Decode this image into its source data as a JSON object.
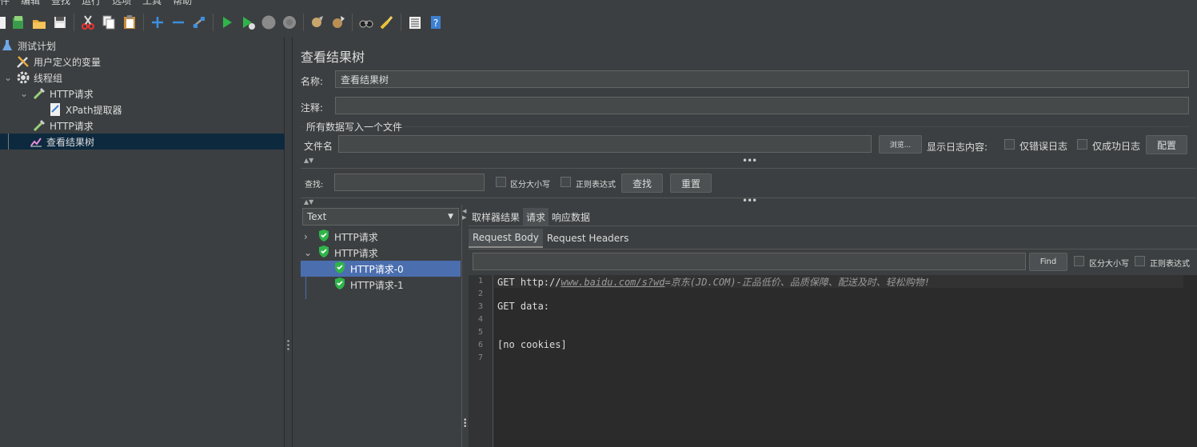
{
  "menubar": [
    "件",
    "编辑",
    "查找",
    "运行",
    "选项",
    "工具",
    "帮助"
  ],
  "toolbar": {
    "icons": [
      "new-file-icon",
      "templates-icon",
      "open-icon",
      "save-icon",
      "cut-icon",
      "copy-icon",
      "paste-icon",
      "expand-icon",
      "collapse-icon",
      "toggle-icon",
      "start-icon",
      "start-no-timers-icon",
      "stop-icon",
      "shutdown-icon",
      "clear-icon",
      "clear-all-icon",
      "search-icon",
      "reset-search-icon",
      "function-helper-icon",
      "help-icon"
    ]
  },
  "tree": {
    "items": [
      {
        "label": "测试计划"
      },
      {
        "label": "用户定义的变量"
      },
      {
        "label": "线程组"
      },
      {
        "label": "HTTP请求"
      },
      {
        "label": "XPath提取器"
      },
      {
        "label": "HTTP请求"
      },
      {
        "label": "查看结果树"
      }
    ]
  },
  "main": {
    "title": "查看结果树",
    "name_label": "名称:",
    "name_value": "查看结果树",
    "comment_label": "注释:",
    "comment_value": "",
    "file_section_label": "所有数据写入一个文件",
    "filename_label": "文件名",
    "filename_value": "",
    "browse_label": "浏览...",
    "log_display_label": "显示日志内容:",
    "errors_only_label": "仅错误日志",
    "success_only_label": "仅成功日志",
    "configure_label": "配置",
    "search_label": "查找:",
    "search_value": "",
    "case_sensitive_label": "区分大小写",
    "regex_label": "正则表达式",
    "find_label": "查找",
    "reset_label": "重置"
  },
  "results": {
    "renderer": "Text",
    "nodes": [
      {
        "label": "HTTP请求"
      },
      {
        "label": "HTTP请求"
      },
      {
        "label": "HTTP请求-0"
      },
      {
        "label": "HTTP请求-1"
      }
    ]
  },
  "detail": {
    "tabs": [
      "取样器结果",
      "请求",
      "响应数据"
    ],
    "subtabs": [
      "Request Body",
      "Request Headers"
    ],
    "find_value": "",
    "find_label": "Find",
    "case_sensitive_label": "区分大小写",
    "regex_label": "正则表达式",
    "lines": {
      "n1": "1",
      "n2": "2",
      "n3": "3",
      "n4": "4",
      "n5": "5",
      "n6": "6",
      "n7": "7",
      "l1_prefix": "GET http://",
      "l1_url": "www.baidu.com/s?wd",
      "l1_eq": "=",
      "l1_query": "京东(JD.COM)-正品低价、品质保障、配送及时、轻松购物!",
      "l3": "GET data:",
      "l6": "[no cookies]"
    }
  },
  "colors": {
    "background": "#3c3f41",
    "selection": "#4b6eaf",
    "tree_selection": "#0d293e",
    "check_green": "#2fb44a"
  }
}
